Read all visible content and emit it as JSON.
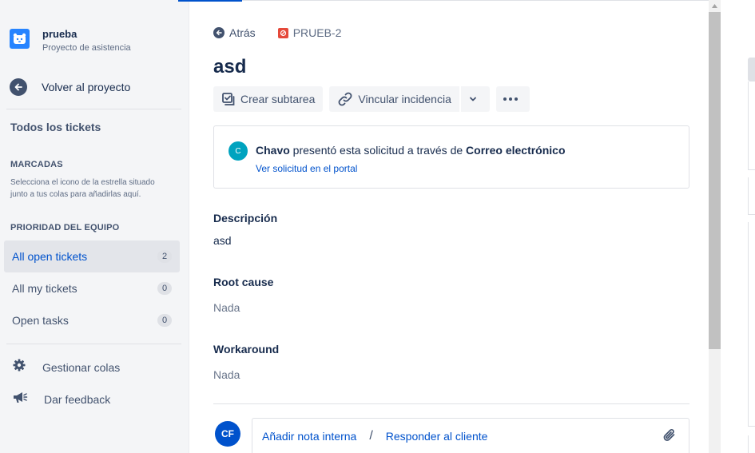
{
  "project": {
    "name": "prueba",
    "type": "Proyecto de asistencia"
  },
  "sidebar": {
    "back_label": "Volver al proyecto",
    "all_tickets": "Todos los tickets",
    "starred_heading": "MARCADAS",
    "starred_note": "Selecciona el icono de la estrella situado junto a tus colas para añadirlas aquí.",
    "team_priority_heading": "PRIORIDAD DEL EQUIPO",
    "queues": [
      {
        "label": "All open tickets",
        "count": "2",
        "active": true
      },
      {
        "label": "All my tickets",
        "count": "0",
        "active": false
      },
      {
        "label": "Open tasks",
        "count": "0",
        "active": false
      }
    ],
    "manage_queues": "Gestionar colas",
    "feedback": "Dar feedback"
  },
  "breadcrumb": {
    "back": "Atrás",
    "issue_key": "PRUEB-2"
  },
  "issue": {
    "title": "asd",
    "toolbar": {
      "create_subtask": "Crear subtarea",
      "link_issue": "Vincular incidencia"
    },
    "request": {
      "avatar_letter": "C",
      "reporter": "Chavo",
      "middle_text": " presentó esta solicitud a través de ",
      "channel": "Correo electrónico",
      "portal_link": "Ver solicitud en el portal"
    },
    "fields": {
      "description_label": "Descripción",
      "description_value": "asd",
      "root_cause_label": "Root cause",
      "root_cause_value": "Nada",
      "workaround_label": "Workaround",
      "workaround_value": "Nada"
    },
    "comment": {
      "user_initials": "CF",
      "internal_note": "Añadir nota interna",
      "separator": "/",
      "reply_customer": "Responder al cliente"
    }
  },
  "colors": {
    "accent": "#0052cc",
    "sidebar_bg": "#f4f5f7",
    "issue_type": "#e5493a",
    "reporter_avatar": "#00a3bf"
  }
}
